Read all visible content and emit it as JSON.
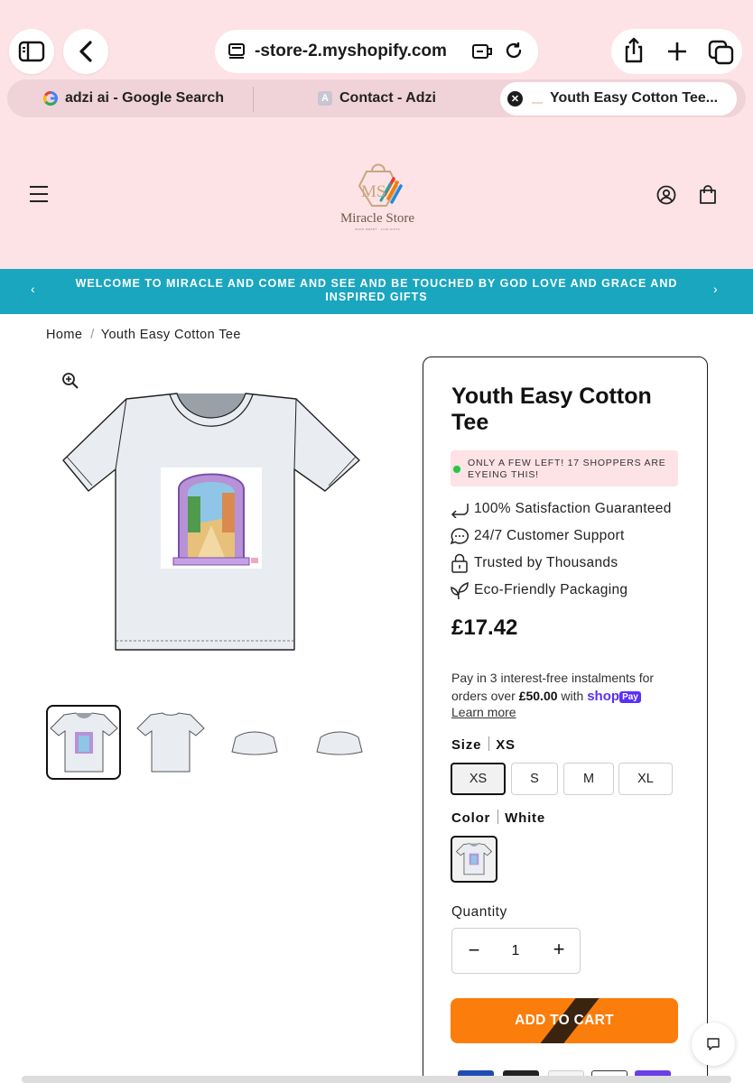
{
  "browser": {
    "url": "-store-2.myshopify.com",
    "tabs": [
      {
        "label": "adzi ai - Google Search",
        "icon": "google-favicon"
      },
      {
        "label": "Contact - Adzi",
        "icon": "letter-a-favicon"
      },
      {
        "label": "Youth Easy Cotton Tee...",
        "icon": "store-favicon",
        "active": true
      }
    ]
  },
  "header": {
    "logo_monogram": "MS",
    "logo_name": "Miracle Store",
    "logo_tagline": "SHOP SMART · LIVE GIFTS"
  },
  "announcement": {
    "text": "WELCOME TO MIRACLE AND COME AND SEE AND BE TOUCHED BY GOD LOVE AND GRACE AND INSPIRED GIFTS"
  },
  "breadcrumb": {
    "home": "Home",
    "separator": "/",
    "current": "Youth Easy Cotton Tee"
  },
  "product": {
    "title": "Youth Easy Cotton Tee",
    "stock_message": "ONLY A FEW LEFT! 17 SHOPPERS ARE EYEING THIS!",
    "features": [
      {
        "label": "100% Satisfaction Guaranteed",
        "icon": "return-arrow-icon"
      },
      {
        "label": "24/7 Customer Support",
        "icon": "chat-bubble-icon"
      },
      {
        "label": "Trusted by Thousands",
        "icon": "lock-icon"
      },
      {
        "label": "Eco-Friendly Packaging",
        "icon": "leaf-sprout-icon"
      }
    ],
    "price": "£17.42",
    "installments": {
      "prefix": "Pay in 3 interest-free instalments for orders over",
      "threshold": "£50.00",
      "suffix": "with",
      "shop_logo": "shop",
      "shop_pay": "Pay",
      "learn_more": "Learn more"
    },
    "size": {
      "label": "Size",
      "selected": "XS",
      "options": [
        "XS",
        "S",
        "M",
        "XL"
      ]
    },
    "color": {
      "label": "Color",
      "selected": "White"
    },
    "quantity": {
      "label": "Quantity",
      "value": "1",
      "minus": "−",
      "plus": "+"
    },
    "add_to_cart": "ADD TO CART"
  },
  "colors": {
    "header_bg": "#fde2e6",
    "announcement_bg": "#1aa6bf",
    "cta_orange": "#fb7d0c",
    "stock_dot": "#2ec24a",
    "shop_pay_purple": "#5a31f4"
  }
}
